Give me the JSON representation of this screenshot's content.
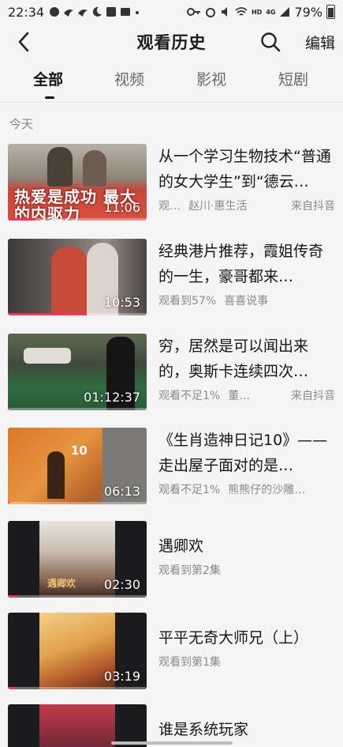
{
  "status": {
    "time": "22:34",
    "battery": "79%",
    "hd": "HD",
    "net": "4G"
  },
  "nav": {
    "title": "观看历史",
    "edit_label": "编辑",
    "back_icon": "chevron-left-icon",
    "search_icon": "search-icon"
  },
  "tabs": [
    {
      "label": "全部",
      "active": true
    },
    {
      "label": "视频",
      "active": false
    },
    {
      "label": "影视",
      "active": false
    },
    {
      "label": "短剧",
      "active": false
    }
  ],
  "section": {
    "label": "今天"
  },
  "accent_color": "#f2365b",
  "items": [
    {
      "title": "从一个学习生物技术“普通的女大学生”到“德云…",
      "thumb_text": "热爱是成功 最大的内驱力",
      "duration": "11:06",
      "progress": "观…",
      "author": "赵川·惠生活",
      "source": "来自抖音"
    },
    {
      "title": "经典港片推荐，霞姐传奇的一生，豪哥都来…",
      "duration": "10:53",
      "progress": "观看到57%",
      "author": "喜喜说事",
      "source": ""
    },
    {
      "title": "穷，居然是可以闻出来的，奥斯卡连续四次…",
      "duration": "01:12:37",
      "progress": "观看不足1%",
      "author": "董…",
      "source": "来自抖音"
    },
    {
      "title": "《生肖造神日记10》——走出屋子面对的是…",
      "thumb_text": "10",
      "duration": "06:13",
      "progress": "观看不足1%",
      "author": "熊熊仔的沙雕…",
      "source": ""
    },
    {
      "title": "遇卿欢",
      "thumb_text": "遇卿欢",
      "duration": "02:30",
      "progress": "观看到第2集",
      "author": "",
      "source": ""
    },
    {
      "title": "平平无奇大师兄（上）",
      "duration": "03:19",
      "progress": "观看到第1集",
      "author": "",
      "source": ""
    },
    {
      "title": "谁是系统玩家",
      "duration": "",
      "progress": "",
      "author": "",
      "source": ""
    }
  ]
}
